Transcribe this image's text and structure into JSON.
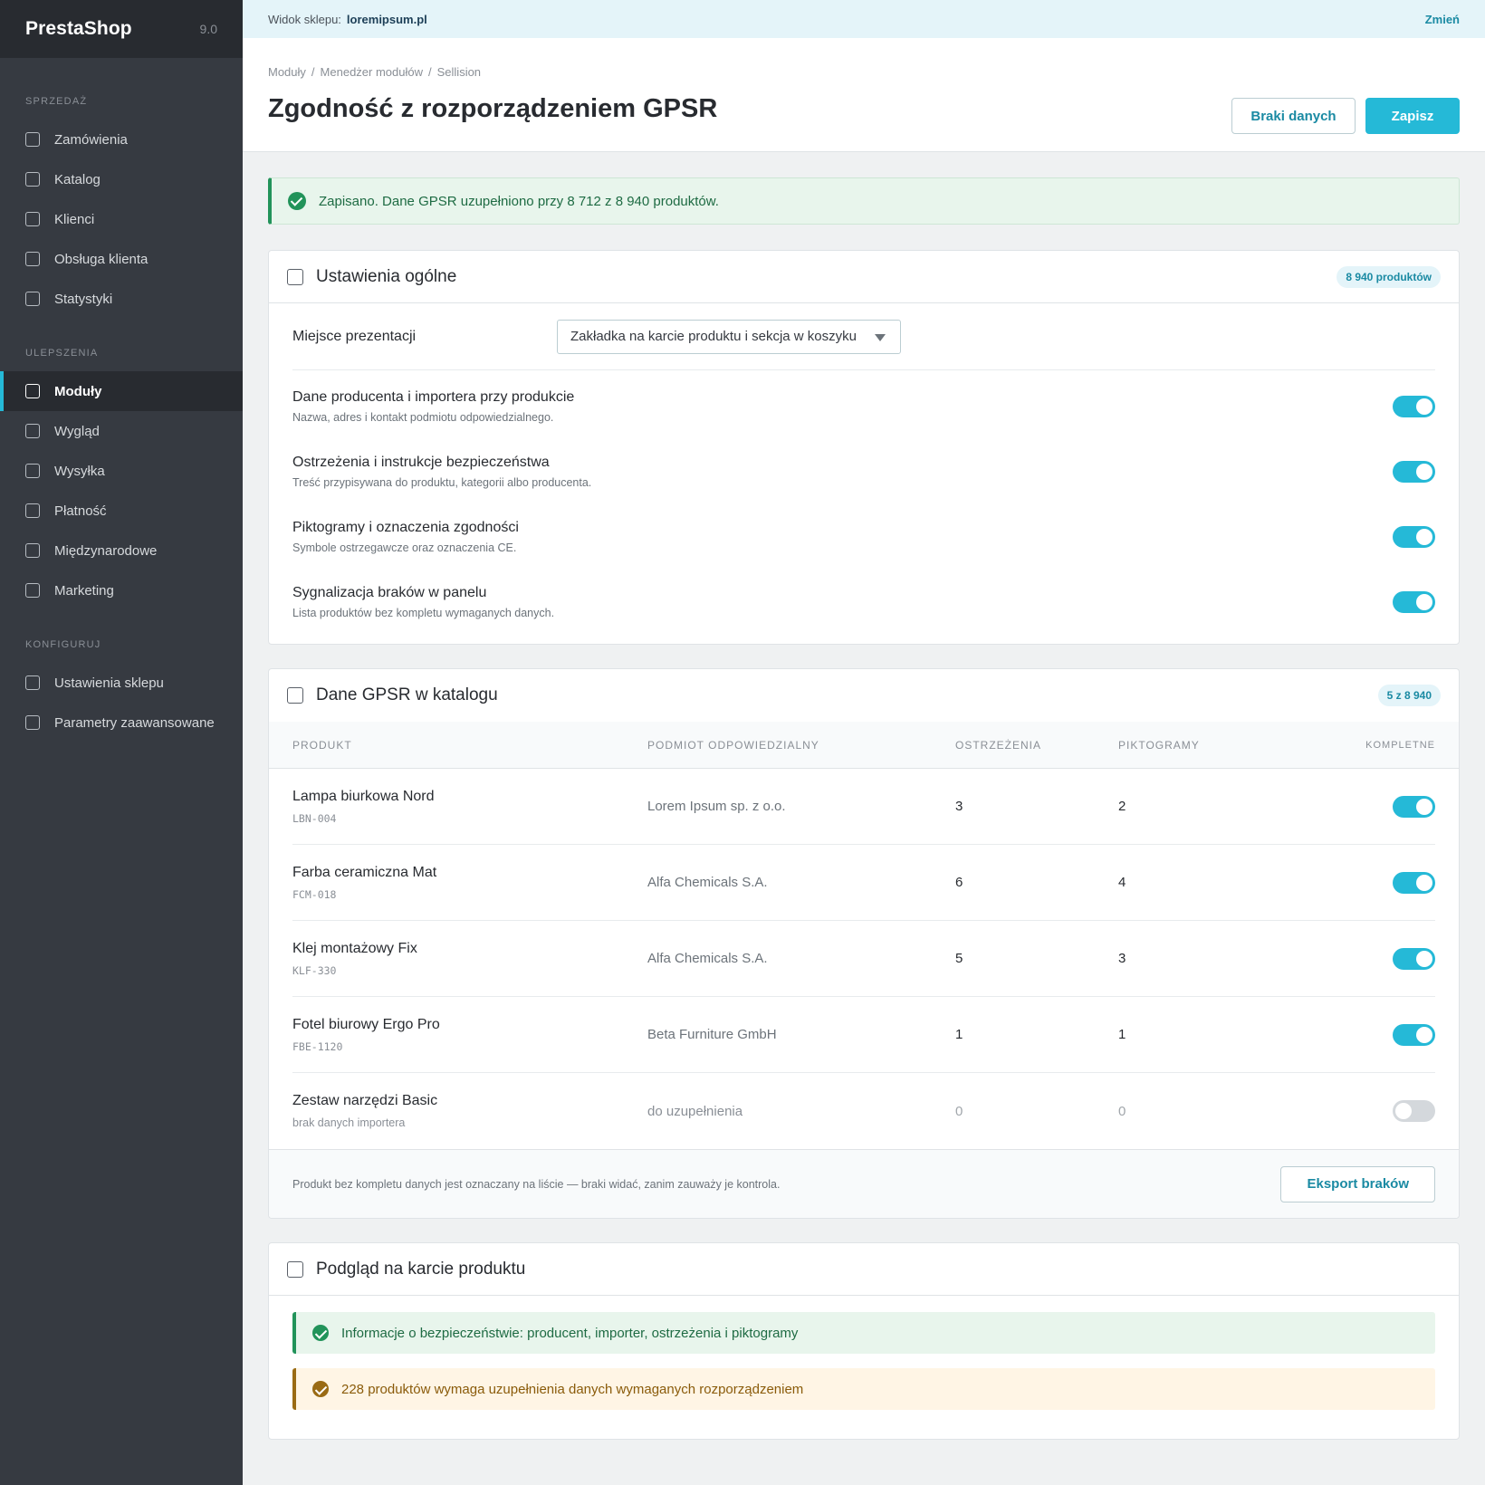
{
  "sidebar": {
    "brand": "PrestaShop",
    "version": "9.0",
    "sections": [
      {
        "title": "SPRZEDAŻ",
        "items": [
          "Zamówienia",
          "Katalog",
          "Klienci",
          "Obsługa klienta",
          "Statystyki"
        ]
      },
      {
        "title": "ULEPSZENIA",
        "items": [
          "Moduły",
          "Wygląd",
          "Wysyłka",
          "Płatność",
          "Międzynarodowe",
          "Marketing"
        ]
      },
      {
        "title": "KONFIGURUJ",
        "items": [
          "Ustawienia sklepu",
          "Parametry zaawansowane"
        ]
      }
    ],
    "active_item": "Moduły"
  },
  "topbar": {
    "label": "Widok sklepu:",
    "shop": "loremipsum.pl",
    "change": "Zmień"
  },
  "header": {
    "breadcrumb": [
      "Moduły",
      "Menedżer modułów",
      "Sellision"
    ],
    "title": "Zgodność z rozporządzeniem GPSR",
    "btn_missing": "Braki danych",
    "btn_save": "Zapisz"
  },
  "alert": {
    "text": "Zapisano. Dane GPSR uzupełniono przy 8 712 z 8 940 produktów."
  },
  "general": {
    "title": "Ustawienia ogólne",
    "badge": "8 940 produktów",
    "placement_label": "Miejsce prezentacji",
    "placement_value": "Zakładka na karcie produktu i sekcja w koszyku",
    "toggles": [
      {
        "title": "Dane producenta i importera przy produkcie",
        "desc": "Nazwa, adres i kontakt podmiotu odpowiedzialnego.",
        "on": true
      },
      {
        "title": "Ostrzeżenia i instrukcje bezpieczeństwa",
        "desc": "Treść przypisywana do produktu, kategorii albo producenta.",
        "on": true
      },
      {
        "title": "Piktogramy i oznaczenia zgodności",
        "desc": "Symbole ostrzegawcze oraz oznaczenia CE.",
        "on": true
      },
      {
        "title": "Sygnalizacja braków w panelu",
        "desc": "Lista produktów bez kompletu wymaganych danych.",
        "on": true
      }
    ]
  },
  "catalog": {
    "title": "Dane GPSR w katalogu",
    "badge": "5 z 8 940",
    "columns": {
      "product": "PRODUKT",
      "subject": "PODMIOT ODPOWIEDZIALNY",
      "warnings": "OSTRZEŻENIA",
      "pictograms": "PIKTOGRAMY",
      "complete": "KOMPLETNE"
    },
    "rows": [
      {
        "name": "Lampa biurkowa Nord",
        "sku": "LBN-004",
        "subject": "Lorem Ipsum sp. z o.o.",
        "warnings": "3",
        "pictograms": "2",
        "complete": true
      },
      {
        "name": "Farba ceramiczna Mat",
        "sku": "FCM-018",
        "subject": "Alfa Chemicals S.A.",
        "warnings": "6",
        "pictograms": "4",
        "complete": true
      },
      {
        "name": "Klej montażowy Fix",
        "sku": "KLF-330",
        "subject": "Alfa Chemicals S.A.",
        "warnings": "5",
        "pictograms": "3",
        "complete": true
      },
      {
        "name": "Fotel biurowy Ergo Pro",
        "sku": "FBE-1120",
        "subject": "Beta Furniture GmbH",
        "warnings": "1",
        "pictograms": "1",
        "complete": true
      },
      {
        "name": "Zestaw narzędzi Basic",
        "sku": "brak danych importera",
        "subject": "do uzupełnienia",
        "warnings": "0",
        "pictograms": "0",
        "complete": false
      }
    ],
    "footer_note": "Produkt bez kompletu danych jest oznaczany na liście — braki widać, zanim zauważy je kontrola.",
    "export_button": "Eksport braków"
  },
  "preview": {
    "title": "Podgląd na karcie produktu",
    "ok_text": "Informacje o bezpieczeństwie: producent, importer, ostrzeżenia i piktogramy",
    "warn_text": "228 produktów wymaga uzupełnienia danych wymaganych rozporządzeniem"
  },
  "colors": {
    "accent": "#25b9d7",
    "sidebar": "#363a41",
    "success": "#22935a",
    "warning": "#9a6b14"
  }
}
